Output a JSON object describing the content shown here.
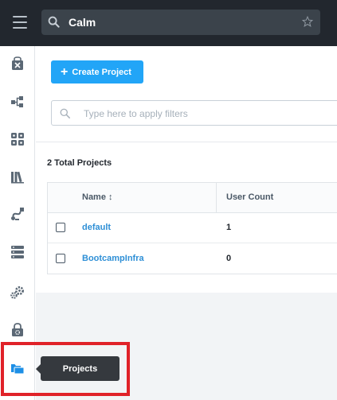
{
  "topbar": {
    "search_value": "Calm"
  },
  "sidebar": {
    "items": [
      {
        "name": "blueprints",
        "icon": "blueprint-icon"
      },
      {
        "name": "applications",
        "icon": "applications-icon"
      },
      {
        "name": "marketplace",
        "icon": "marketplace-icon"
      },
      {
        "name": "library",
        "icon": "library-icon"
      },
      {
        "name": "runbooks",
        "icon": "runbook-icon"
      },
      {
        "name": "endpoints",
        "icon": "endpoints-icon"
      },
      {
        "name": "settings",
        "icon": "settings-icon"
      },
      {
        "name": "policies",
        "icon": "policy-icon"
      },
      {
        "name": "projects",
        "icon": "projects-icon",
        "active": true
      }
    ],
    "tooltip": "Projects"
  },
  "main": {
    "create_button": "Create Project",
    "filter_placeholder": "Type here to apply filters",
    "total_label": "2 Total Projects",
    "table": {
      "columns": [
        "Name ↕",
        "User Count"
      ],
      "rows": [
        {
          "name": "default",
          "user_count": "1"
        },
        {
          "name": "BootcampInfra",
          "user_count": "0"
        }
      ]
    }
  },
  "colors": {
    "topbar_bg": "#22272e",
    "accent": "#22a5f7",
    "link": "#2e8fd6",
    "highlight": "#e02229"
  }
}
